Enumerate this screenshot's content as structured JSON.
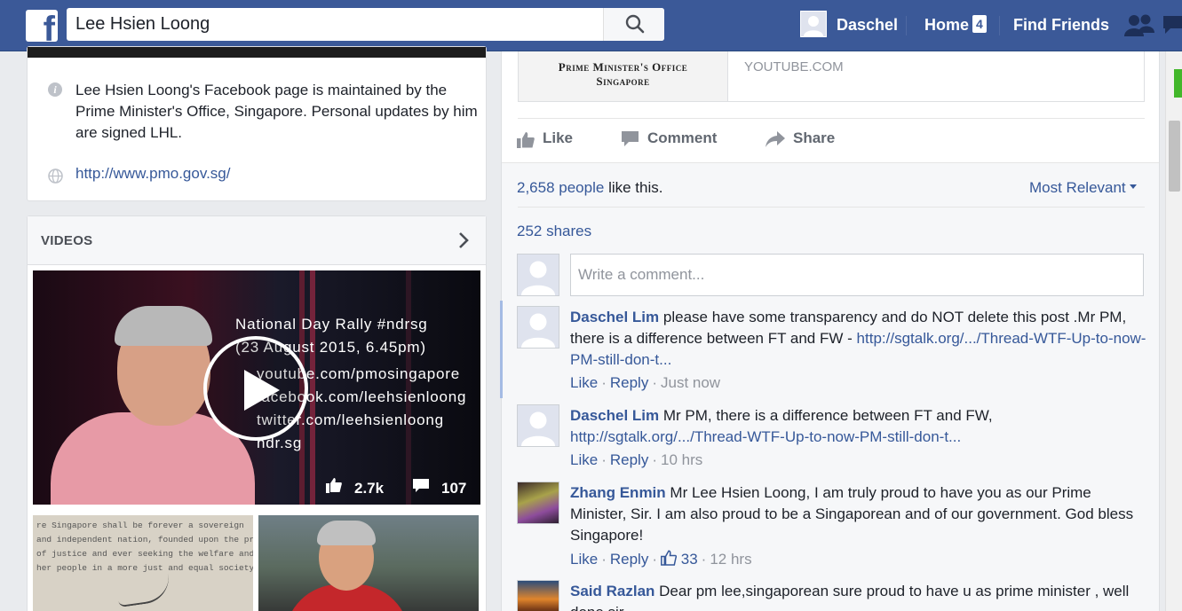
{
  "topbar": {
    "search_value": "Lee Hsien Loong",
    "user_name": "Daschel",
    "home_label": "Home",
    "home_badge": "4",
    "find_friends_label": "Find Friends"
  },
  "about": {
    "description": "Lee Hsien Loong's Facebook page is maintained by the Prime Minister's Office, Singapore. Personal updates by him are signed LHL.",
    "website": "http://www.pmo.gov.sg/"
  },
  "videos": {
    "title": "VIDEOS",
    "main": {
      "line1": "National Day Rally #ndrsg",
      "line2": "(23 August 2015, 6.45pm)",
      "line3": "youtube.com/pmosingapore",
      "line4": "facebook.com/leehsienloong",
      "line5": "twitter.com/leehsienloong",
      "line6": "ndr.sg",
      "likes": "2.7k",
      "comments": "107"
    },
    "thumb1_text": "re Singapore shall be forever a sovereign\nand independent nation, founded upon the principles\nof justice and ever seeking the welfare and\nher people in a more just and equal society."
  },
  "post": {
    "link_logo_line1": "Prime Minister's Office",
    "link_logo_line2": "Singapore",
    "link_domain": "YOUTUBE.COM",
    "actions": {
      "like": "Like",
      "comment": "Comment",
      "share": "Share"
    },
    "likes_count": "2,658 people",
    "likes_suffix": "like this.",
    "sort_label": "Most Relevant",
    "shares": "252 shares",
    "comment_placeholder": "Write a comment..."
  },
  "comments": [
    {
      "author": "Daschel Lim",
      "text_part1": "please have some transparency and do NOT delete this post .Mr PM, there is a difference between FT and FW -",
      "link": "http://sgtalk.org/.../Thread-WTF-Up-to-now-PM-still-don-t...",
      "like": "Like",
      "reply": "Reply",
      "time": "Just now"
    },
    {
      "author": "Daschel Lim",
      "text_part1": "Mr PM, there is a difference between FT and FW,",
      "link": "http://sgtalk.org/.../Thread-WTF-Up-to-now-PM-still-don-t...",
      "like": "Like",
      "reply": "Reply",
      "time": "10 hrs"
    },
    {
      "author": "Zhang Enmin",
      "text_part1": "Mr Lee Hsien Loong, I am truly proud to have you as our Prime Minister, Sir. I am also proud to be a Singaporean and of our government. God bless Singapore!",
      "like": "Like",
      "reply": "Reply",
      "likes": "33",
      "time": "12 hrs"
    },
    {
      "author": "Said Razlan",
      "text_part1": "Dear pm lee,singaporean sure proud to have u as prime minister , well done sir"
    }
  ],
  "colors": {
    "brand": "#3b5998",
    "link": "#365899",
    "meta": "#90949c"
  }
}
